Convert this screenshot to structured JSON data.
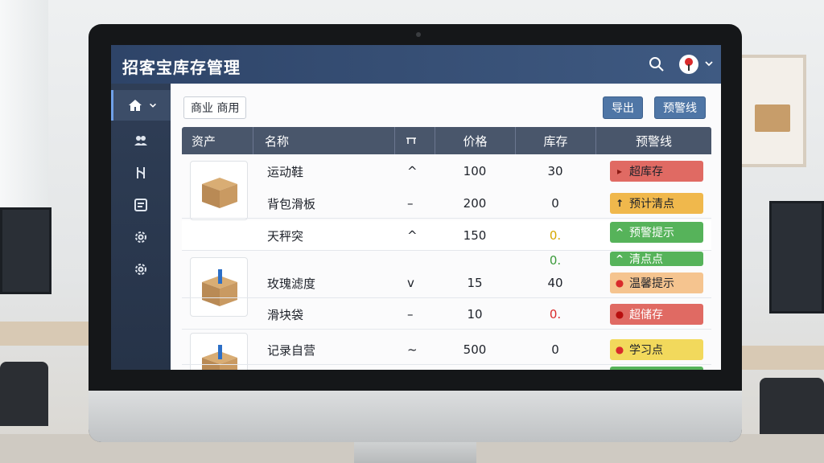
{
  "app": {
    "title": "招客宝库存管理"
  },
  "topbar": {
    "search_icon": "search-icon",
    "avatar_icon": "user-avatar-icon",
    "chevron_icon": "chevron-down-icon"
  },
  "sidebar": {
    "items": [
      {
        "icon": "home-icon",
        "active": true
      },
      {
        "icon": "users-icon",
        "active": false
      },
      {
        "icon": "branch-icon",
        "active": false
      },
      {
        "icon": "document-icon",
        "active": false
      },
      {
        "icon": "gear-icon",
        "active": false
      },
      {
        "icon": "gear-icon",
        "active": false
      }
    ]
  },
  "toolbar": {
    "filter_label": "商业  商用",
    "button_1": "导出",
    "button_2": "预警线"
  },
  "table": {
    "headers": [
      "资产",
      "名称",
      "",
      "价格",
      "库存",
      "预警线"
    ],
    "rows": [
      {
        "name": "运动鞋",
        "trend": "^",
        "price": "100",
        "stock": "30",
        "badge": {
          "text": "超库存",
          "color": "#e06a63",
          "icon": "▸"
        }
      },
      {
        "name": "背包滑板",
        "trend": "–",
        "price": "200",
        "stock": "0",
        "badge": {
          "text": "预计清点",
          "color": "#f0b84c",
          "icon": "↑"
        }
      },
      {
        "name": "天秤突",
        "trend": "^",
        "price": "150",
        "stock": "0.",
        "stock_color": "yellow",
        "badge": {
          "text": "预警提示",
          "color": "#56b35a",
          "icon": "^"
        }
      },
      {
        "name": "",
        "trend": "",
        "price": "",
        "stock": "0.",
        "stock_color": "green",
        "badge": {
          "text": "清点点",
          "color": "#56b35a",
          "icon": "^"
        }
      },
      {
        "name": "玫瑰滤度",
        "trend": "v",
        "price": "15",
        "stock": "40",
        "badge": {
          "text": "温馨提示",
          "color": "#f5c48f",
          "icon": "●"
        }
      },
      {
        "name": "滑块袋",
        "trend": "–",
        "price": "10",
        "stock": "0.",
        "stock_color": "red",
        "badge": {
          "text": "超储存",
          "color": "#e06a63",
          "icon": "●"
        }
      },
      {
        "name": "记录自营",
        "trend": "~",
        "price": "500",
        "stock": "0",
        "badge": {
          "text": "学习点",
          "color": "#f2d95c",
          "icon": "●"
        }
      }
    ]
  },
  "colors": {
    "topbar": "#2e4468",
    "sidebar": "#2f3e56",
    "accent": "#4f76a6",
    "header": "#49566b"
  }
}
